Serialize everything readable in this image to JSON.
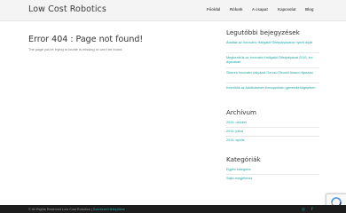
{
  "header": {
    "site_title": "Low Cost Robotics",
    "nav": [
      "Főoldal",
      "Rólunk",
      "A csapat",
      "Kapcsolat",
      "Blog"
    ]
  },
  "main": {
    "heading": "Error 404 : Page not found!",
    "subtext": "The page you're trying to locate is missing or can't be found."
  },
  "sidebar": {
    "recent_title": "Legutóbbi bejegyzések",
    "recent_posts": [
      "Átadták az Innovatív Hallgatói Ötletpályázatok nyerő díjait",
      "Megkezdtük az Innovatív Hallgatói Ötletpályázat 2016. évi díjazásait",
      "Sikeres Innovatív pályázat Gerzsó Tibunló Award díjazása",
      "Kezdődik az Adottdávider Ketroppétaló gyerekikéridgéjében"
    ],
    "archive_title": "Archívum",
    "archive_items": [
      "2016. október",
      "2016. július",
      "2016. április"
    ],
    "category_title": "Kategóriák",
    "category_items": [
      "Egyéb kategória",
      "Sajtó-megjelenés"
    ]
  },
  "footer": {
    "copyright": "© All Rights Reserved Low Cost Robotics |",
    "link_label": "Szerkezeti felépülése"
  },
  "colors": {
    "accent": "#1fa7a5",
    "footer_bg": "#1d1d1d",
    "header_bg": "#f4f4f4"
  },
  "icons": {
    "footer_left": "instagram-icon",
    "footer_right": "facebook-icon",
    "badge": "recaptcha-icon"
  }
}
